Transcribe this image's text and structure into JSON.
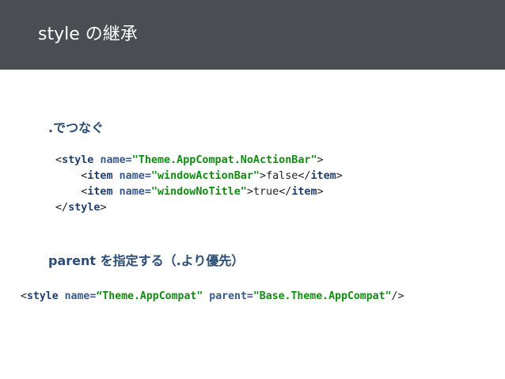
{
  "slide": {
    "title": "style の継承"
  },
  "section1": {
    "heading": ".でつなぐ",
    "code": {
      "line1": {
        "open": "<",
        "tag": "style",
        "attr": "name=",
        "value": "\"Theme.AppCompat.NoActionBar\"",
        "close": ">"
      },
      "line2": {
        "open": "<",
        "tag": "item",
        "attr": "name=",
        "value": "\"windowActionBar\"",
        "mid": ">",
        "text": "false",
        "end_open": "</",
        "end_tag": "item",
        "close": ">"
      },
      "line3": {
        "open": "<",
        "tag": "item",
        "attr": "name=",
        "value": "\"windowNoTitle\"",
        "mid": ">",
        "text": "true",
        "end_open": "</",
        "end_tag": "item",
        "close": ">"
      },
      "line4": {
        "open": "</",
        "tag": "style",
        "close": ">"
      }
    }
  },
  "section2": {
    "heading": "parent を指定する（.より優先）",
    "code": {
      "open": "<",
      "tag": "style",
      "attr1": "name=",
      "value1": "“Theme.AppCompat\"",
      "attr2": "parent=",
      "value2": "\"Base.Theme.AppCompat\"",
      "close": "/>"
    }
  }
}
